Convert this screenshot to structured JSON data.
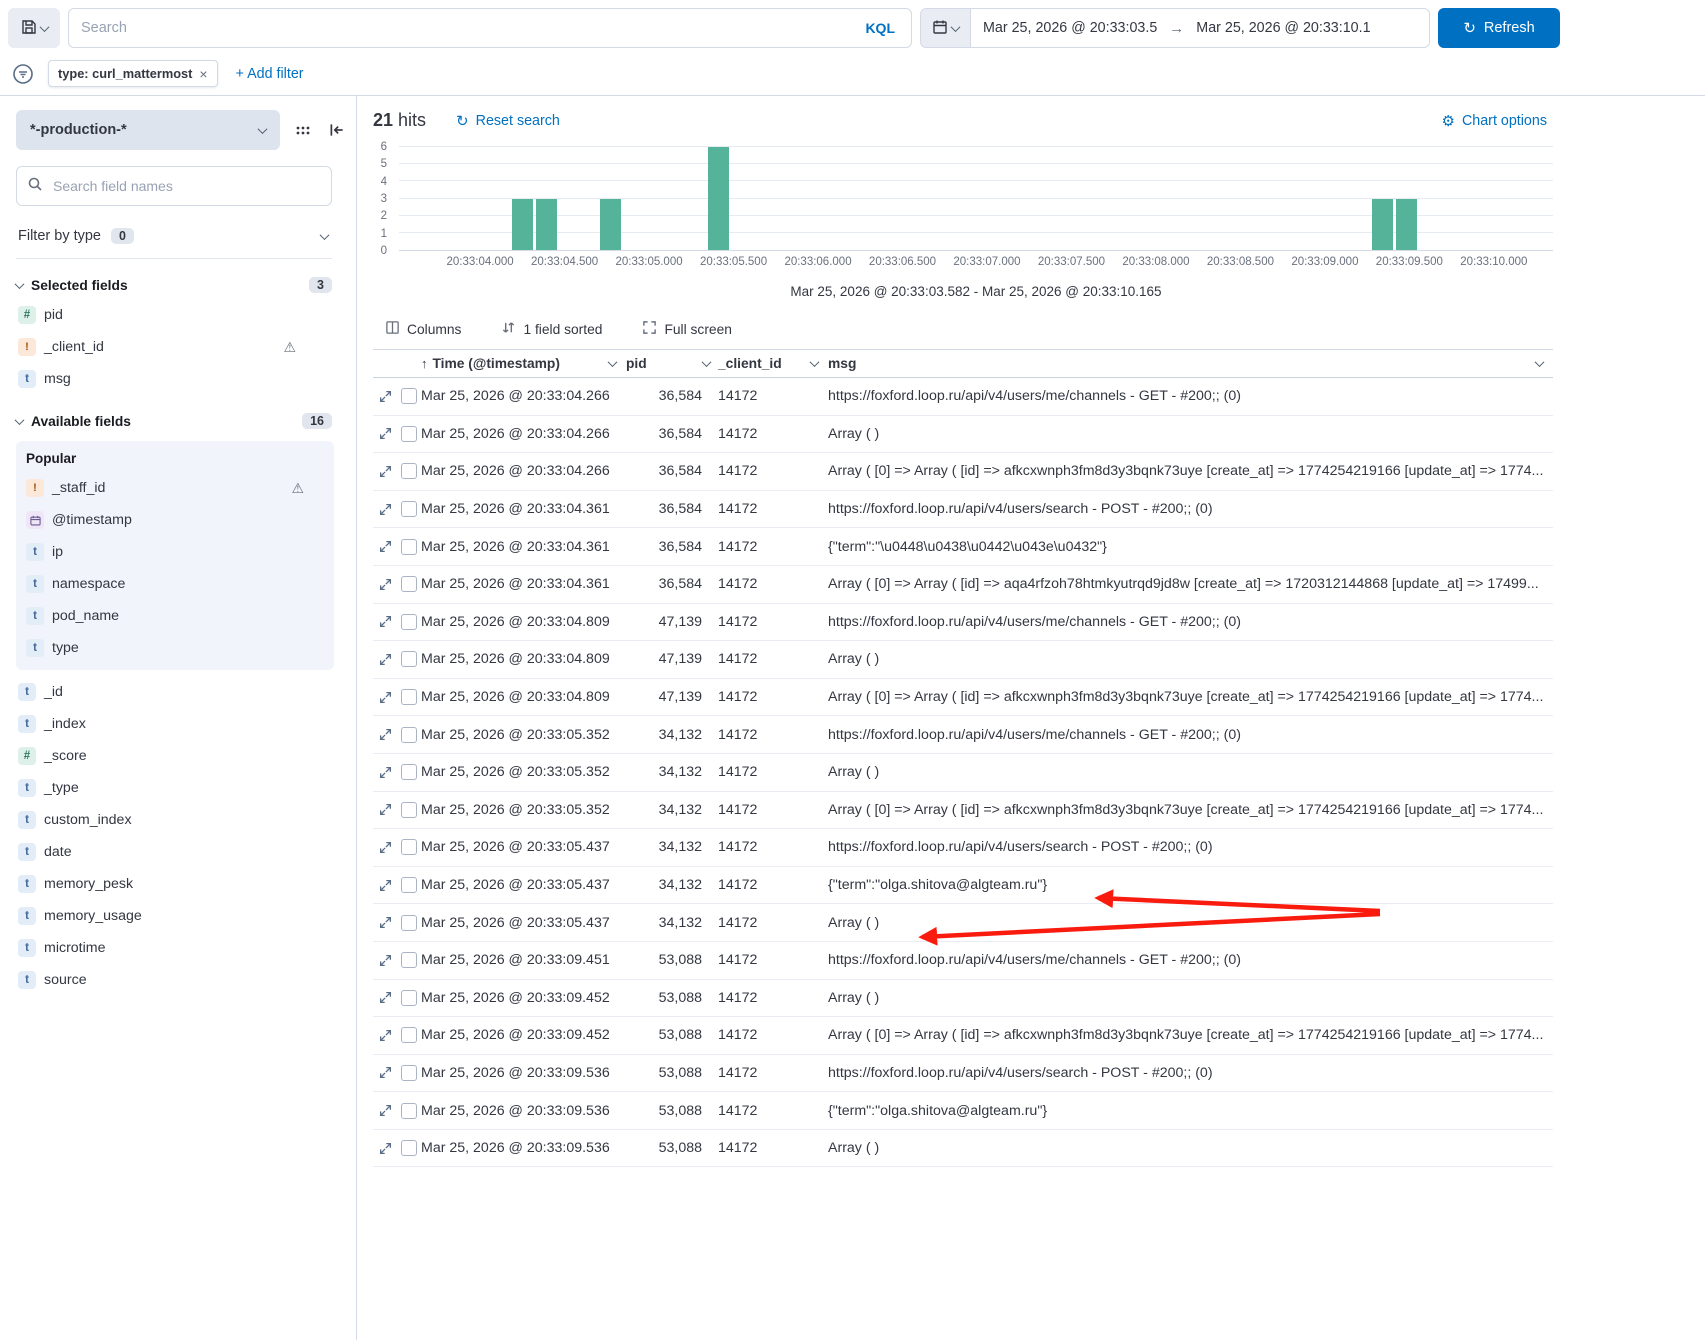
{
  "icons": {
    "warning": "⚠",
    "gear": "⚙",
    "sort_asc": "↑",
    "arrow_right": "→",
    "refresh": "↻",
    "close": "×"
  },
  "colors": {
    "accent": "#0071C2",
    "bar": "#54B399",
    "arrow": "#FA1B0F"
  },
  "topbar": {
    "search_placeholder": "Search",
    "kql_label": "KQL",
    "date_from": "Mar 25, 2026 @ 20:33:03.5",
    "date_to": "Mar 25, 2026 @ 20:33:10.1",
    "refresh_label": "Refresh"
  },
  "filter_bar": {
    "chip_label": "type: curl_mattermost",
    "add_filter_label": "+ Add filter"
  },
  "sidebar": {
    "index_pattern": "*-production-*",
    "field_search_placeholder": "Search field names",
    "filter_by_type_label": "Filter by type",
    "filter_by_type_count": "0",
    "selected": {
      "label": "Selected fields",
      "count": "3",
      "fields": [
        {
          "icon": "number",
          "name": "pid"
        },
        {
          "icon": "conflict",
          "name": "_client_id",
          "warn": true
        },
        {
          "icon": "text",
          "name": "msg"
        }
      ]
    },
    "available": {
      "label": "Available fields",
      "count": "16",
      "popular_label": "Popular",
      "popular_fields": [
        {
          "icon": "conflict",
          "name": "_staff_id",
          "warn": true
        },
        {
          "icon": "date",
          "name": "@timestamp"
        },
        {
          "icon": "text",
          "name": "ip"
        },
        {
          "icon": "text",
          "name": "namespace"
        },
        {
          "icon": "text",
          "name": "pod_name"
        },
        {
          "icon": "text",
          "name": "type"
        }
      ],
      "fields": [
        {
          "icon": "text",
          "name": "_id"
        },
        {
          "icon": "text",
          "name": "_index"
        },
        {
          "icon": "number",
          "name": "_score"
        },
        {
          "icon": "text",
          "name": "_type"
        },
        {
          "icon": "text",
          "name": "custom_index"
        },
        {
          "icon": "text",
          "name": "date"
        },
        {
          "icon": "text",
          "name": "memory_pesk"
        },
        {
          "icon": "text",
          "name": "memory_usage"
        },
        {
          "icon": "text",
          "name": "microtime"
        },
        {
          "icon": "text",
          "name": "source"
        }
      ]
    }
  },
  "main": {
    "hits_value": "21",
    "hits_label": "hits",
    "reset_search_label": "Reset search",
    "chart_options_label": "Chart options",
    "toolbar": {
      "columns_label": "Columns",
      "sorted_label": "1 field sorted",
      "fullscreen_label": "Full screen"
    },
    "table": {
      "headers": {
        "time": "Time (@timestamp)",
        "pid": "pid",
        "client_id": "_client_id",
        "msg": "msg"
      },
      "rows": [
        [
          "Mar 25, 2026 @ 20:33:04.266",
          "36,584",
          "14172",
          "https://foxford.loop.ru/api/v4/users/me/channels - GET - #200;; (0)"
        ],
        [
          "Mar 25, 2026 @ 20:33:04.266",
          "36,584",
          "14172",
          "Array ( )"
        ],
        [
          "Mar 25, 2026 @ 20:33:04.266",
          "36,584",
          "14172",
          "Array ( [0] => Array ( [id] => afkcxwnph3fm8d3y3bqnk73uye [create_at] => 1774254219166 [update_at] => 1774..."
        ],
        [
          "Mar 25, 2026 @ 20:33:04.361",
          "36,584",
          "14172",
          "https://foxford.loop.ru/api/v4/users/search - POST - #200;; (0)"
        ],
        [
          "Mar 25, 2026 @ 20:33:04.361",
          "36,584",
          "14172",
          "{\"term\":\"\\u0448\\u0438\\u0442\\u043e\\u0432\"}"
        ],
        [
          "Mar 25, 2026 @ 20:33:04.361",
          "36,584",
          "14172",
          "Array ( [0] => Array ( [id] => aqa4rfzoh78htmkyutrqd9jd8w [create_at] => 1720312144868 [update_at] => 17499..."
        ],
        [
          "Mar 25, 2026 @ 20:33:04.809",
          "47,139",
          "14172",
          "https://foxford.loop.ru/api/v4/users/me/channels - GET - #200;; (0)"
        ],
        [
          "Mar 25, 2026 @ 20:33:04.809",
          "47,139",
          "14172",
          "Array ( )"
        ],
        [
          "Mar 25, 2026 @ 20:33:04.809",
          "47,139",
          "14172",
          "Array ( [0] => Array ( [id] => afkcxwnph3fm8d3y3bqnk73uye [create_at] => 1774254219166 [update_at] => 1774..."
        ],
        [
          "Mar 25, 2026 @ 20:33:05.352",
          "34,132",
          "14172",
          "https://foxford.loop.ru/api/v4/users/me/channels - GET - #200;; (0)"
        ],
        [
          "Mar 25, 2026 @ 20:33:05.352",
          "34,132",
          "14172",
          "Array ( )"
        ],
        [
          "Mar 25, 2026 @ 20:33:05.352",
          "34,132",
          "14172",
          "Array ( [0] => Array ( [id] => afkcxwnph3fm8d3y3bqnk73uye [create_at] => 1774254219166 [update_at] => 1774..."
        ],
        [
          "Mar 25, 2026 @ 20:33:05.437",
          "34,132",
          "14172",
          "https://foxford.loop.ru/api/v4/users/search - POST - #200;; (0)"
        ],
        [
          "Mar 25, 2026 @ 20:33:05.437",
          "34,132",
          "14172",
          "{\"term\":\"olga.shitova@algteam.ru\"}"
        ],
        [
          "Mar 25, 2026 @ 20:33:05.437",
          "34,132",
          "14172",
          "Array ( )"
        ],
        [
          "Mar 25, 2026 @ 20:33:09.451",
          "53,088",
          "14172",
          "https://foxford.loop.ru/api/v4/users/me/channels - GET - #200;; (0)"
        ],
        [
          "Mar 25, 2026 @ 20:33:09.452",
          "53,088",
          "14172",
          "Array ( )"
        ],
        [
          "Mar 25, 2026 @ 20:33:09.452",
          "53,088",
          "14172",
          "Array ( [0] => Array ( [id] => afkcxwnph3fm8d3y3bqnk73uye [create_at] => 1774254219166 [update_at] => 1774..."
        ],
        [
          "Mar 25, 2026 @ 20:33:09.536",
          "53,088",
          "14172",
          "https://foxford.loop.ru/api/v4/users/search - POST - #200;; (0)"
        ],
        [
          "Mar 25, 2026 @ 20:33:09.536",
          "53,088",
          "14172",
          "{\"term\":\"olga.shitova@algteam.ru\"}"
        ],
        [
          "Mar 25, 2026 @ 20:33:09.536",
          "53,088",
          "14172",
          "Array ( )"
        ]
      ]
    }
  },
  "chart_data": {
    "type": "bar",
    "title": "",
    "xlabel": "",
    "ylabel": "",
    "ylim": [
      0,
      6
    ],
    "y_ticks": [
      0,
      1,
      2,
      3,
      4,
      5,
      6
    ],
    "x_domain_seconds": [
      3.52,
      10.35
    ],
    "x_ticks": [
      {
        "t": 4.0,
        "label": "20:33:04.000"
      },
      {
        "t": 4.5,
        "label": "20:33:04.500"
      },
      {
        "t": 5.0,
        "label": "20:33:05.000"
      },
      {
        "t": 5.5,
        "label": "20:33:05.500"
      },
      {
        "t": 6.0,
        "label": "20:33:06.000"
      },
      {
        "t": 6.5,
        "label": "20:33:06.500"
      },
      {
        "t": 7.0,
        "label": "20:33:07.000"
      },
      {
        "t": 7.5,
        "label": "20:33:07.500"
      },
      {
        "t": 8.0,
        "label": "20:33:08.000"
      },
      {
        "t": 8.5,
        "label": "20:33:08.500"
      },
      {
        "t": 9.0,
        "label": "20:33:09.000"
      },
      {
        "t": 9.5,
        "label": "20:33:09.500"
      },
      {
        "t": 10.0,
        "label": "20:33:10.000"
      }
    ],
    "bars": [
      {
        "t": 4.25,
        "count": 3
      },
      {
        "t": 4.39,
        "count": 3
      },
      {
        "t": 4.77,
        "count": 3
      },
      {
        "t": 5.41,
        "count": 6
      },
      {
        "t": 9.34,
        "count": 3
      },
      {
        "t": 9.48,
        "count": 3
      }
    ],
    "bar_color": "#54B399",
    "grid": true,
    "legend": false,
    "caption": "Mar 25, 2026 @ 20:33:03.582 - Mar 25, 2026 @ 20:33:10.165"
  }
}
